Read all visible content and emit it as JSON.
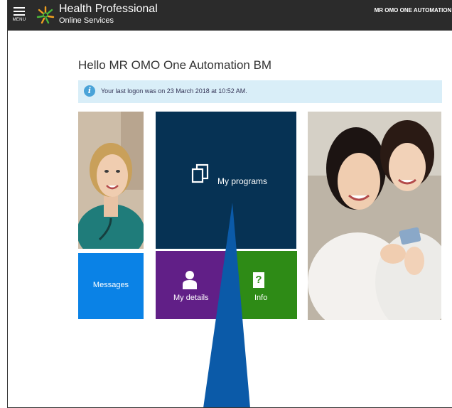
{
  "header": {
    "menu_label": "MENU",
    "brand_line1": "Health Professional",
    "brand_line2": "Online Services",
    "user_name": "MR OMO ONE AUTOMATION BM"
  },
  "main": {
    "greeting": "Hello MR OMO One Automation BM",
    "last_logon_notice": "Your last logon was on 23 March 2018 at 10:52 AM."
  },
  "tiles": {
    "programs": "My programs",
    "messages": "Messages",
    "details": "My details",
    "info_icon_glyph": "?",
    "info": "Info"
  },
  "icons": {
    "menu": "hamburger-icon",
    "logo": "health-logo-icon",
    "info": "info-icon",
    "programs": "copy-pages-icon",
    "details": "person-icon",
    "info_tile": "question-icon"
  },
  "colors": {
    "topbar": "#2b2b2b",
    "notice_bg": "#d9eef8",
    "programs": "#063254",
    "messages": "#0a82e6",
    "details": "#611f87",
    "info": "#2e8b16",
    "arrow": "#0b5aa8"
  }
}
